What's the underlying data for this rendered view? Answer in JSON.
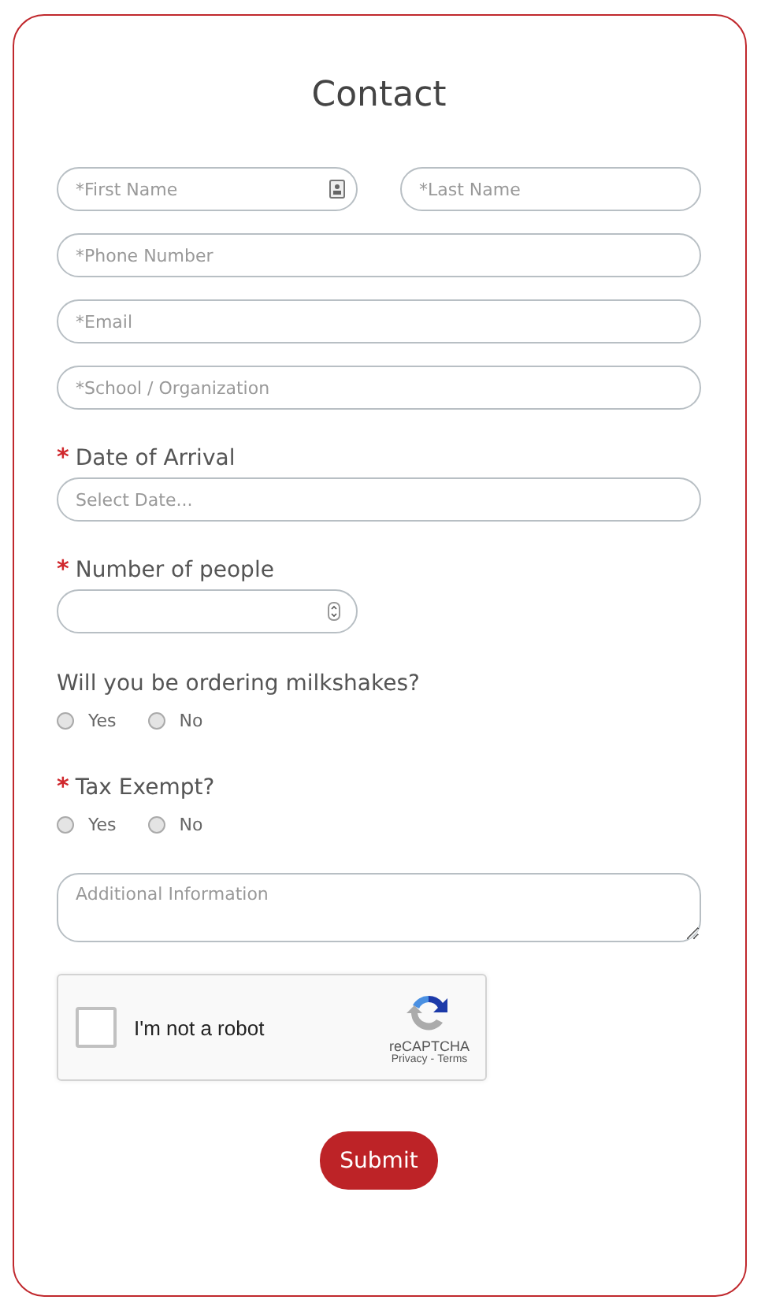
{
  "title": "Contact",
  "name_row": [
    {
      "placeholder": "*First Name",
      "autofill_icon": true
    },
    {
      "placeholder": "*Last Name",
      "autofill_icon": false
    }
  ],
  "fields": [
    {
      "placeholder": "*Phone Number"
    },
    {
      "placeholder": "*Email"
    },
    {
      "placeholder": "*School / Organization"
    }
  ],
  "date": {
    "required_marker": "*",
    "label": "Date of Arrival",
    "placeholder": "Select Date..."
  },
  "people": {
    "required_marker": "*",
    "label": "Number of people"
  },
  "radio_questions": [
    {
      "label": "Will you be ordering milkshakes?",
      "options": [
        {
          "label": "Yes",
          "selected": false
        },
        {
          "label": "No",
          "selected": false
        }
      ]
    },
    {
      "required_marker": "*",
      "label": "Tax Exempt?",
      "options": [
        {
          "label": "Yes",
          "selected": false
        },
        {
          "label": "No",
          "selected": false
        }
      ]
    }
  ],
  "additional": {
    "placeholder": "Additional Information"
  },
  "captcha": {
    "label": "I'm not a robot",
    "checked": false,
    "brand": "reCAPTCHA",
    "privacy": "Privacy",
    "separator": "-",
    "terms": "Terms"
  },
  "submit": "Submit"
}
